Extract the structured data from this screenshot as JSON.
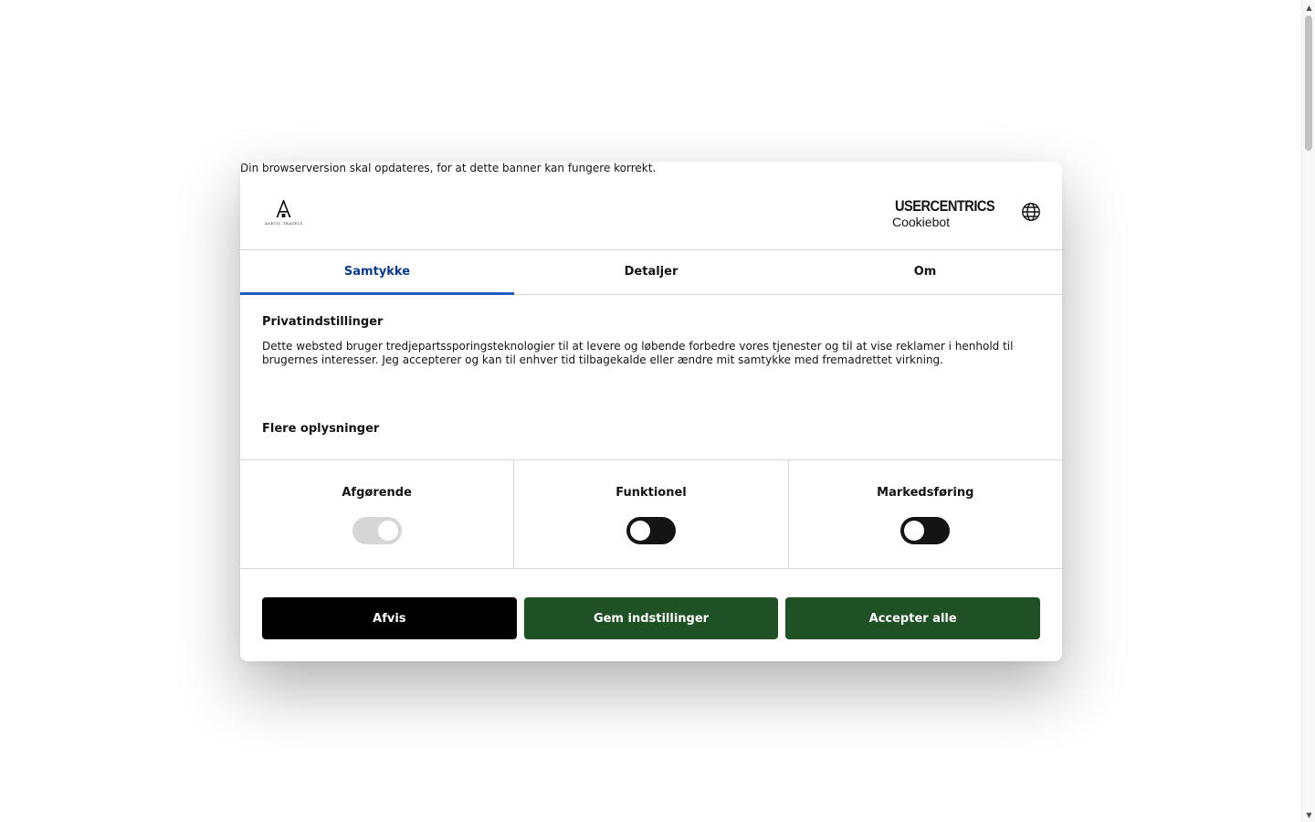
{
  "banner": {
    "browser_warning": "Din browserversion skal opdateres, for at dette banner kan fungere korrekt.",
    "brand_logo_text": "ASETIC TRAVELS",
    "cookiebot_logo": {
      "line1": "USERCENTRICS",
      "line2": "Cookiebot"
    },
    "language_icon": "globe-icon"
  },
  "tabs": [
    {
      "label": "Samtykke",
      "active": true
    },
    {
      "label": "Detaljer",
      "active": false
    },
    {
      "label": "Om",
      "active": false
    }
  ],
  "consent": {
    "title": "Privatindstillinger",
    "text": "Dette websted bruger tredjepartssporingsteknologier til at levere og løbende forbedre vores tjenester og til at vise reklamer i henhold til brugernes interesser. Jeg accepterer og kan til enhver tid tilbagekalde eller ændre mit samtykke med fremadrettet virkning.",
    "more_info": "Flere oplysninger"
  },
  "toggles": [
    {
      "label": "Afgørende",
      "checked": true,
      "disabled": true
    },
    {
      "label": "Funktionel",
      "checked": false,
      "disabled": false
    },
    {
      "label": "Markedsføring",
      "checked": false,
      "disabled": false
    }
  ],
  "buttons": {
    "deny": "Afvis",
    "save": "Gem indstillinger",
    "accept": "Accepter alle"
  },
  "colors": {
    "primary_green": "#1f5125",
    "deny_black": "#000000",
    "active_tab_text": "#0b3a8c",
    "active_tab_underline": "#1d5bbf",
    "divider": "#d6d6d6"
  }
}
